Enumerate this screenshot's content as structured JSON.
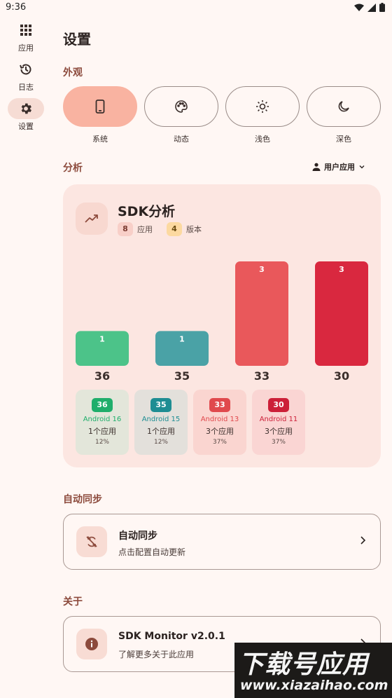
{
  "status_bar": {
    "time": "9:36"
  },
  "nav_rail": {
    "items": [
      {
        "label": "应用",
        "icon": "grid-icon",
        "active": false
      },
      {
        "label": "日志",
        "icon": "history-icon",
        "active": false
      },
      {
        "label": "设置",
        "icon": "gear-icon",
        "active": true
      }
    ]
  },
  "page": {
    "title": "设置"
  },
  "appearance": {
    "section_title": "外观",
    "options": [
      {
        "label": "系统",
        "icon": "phone-icon",
        "selected": true
      },
      {
        "label": "动态",
        "icon": "palette-icon",
        "selected": false
      },
      {
        "label": "浅色",
        "icon": "sun-icon",
        "selected": false
      },
      {
        "label": "深色",
        "icon": "moon-icon",
        "selected": false
      }
    ]
  },
  "analysis": {
    "section_title": "分析",
    "filter_label": "用户应用"
  },
  "sdk_card": {
    "title": "SDK分析",
    "apps_count": "8",
    "apps_label": "应用",
    "versions_count": "4",
    "versions_label": "版本"
  },
  "chart_data": {
    "type": "bar",
    "categories": [
      "36",
      "35",
      "33",
      "30"
    ],
    "values": [
      1,
      1,
      3,
      3
    ],
    "ylim": [
      0,
      3
    ],
    "colors": [
      "#4cc389",
      "#4aa2a6",
      "#e9585b",
      "#d9283f"
    ]
  },
  "legend_cards": [
    {
      "sdk": "36",
      "version": "Android 16",
      "apps": "1个应用",
      "percent": "12%",
      "color": "#1fae6b",
      "bg": "#e3e6da"
    },
    {
      "sdk": "35",
      "version": "Android 15",
      "apps": "1个应用",
      "percent": "12%",
      "color": "#1e8d93",
      "bg": "#e3e0db"
    },
    {
      "sdk": "33",
      "version": "Android 13",
      "apps": "3个应用",
      "percent": "37%",
      "color": "#e0494d",
      "bg": "#fad5d0"
    },
    {
      "sdk": "30",
      "version": "Android 11",
      "apps": "3个应用",
      "percent": "37%",
      "color": "#cc1f38",
      "bg": "#fad5d3"
    }
  ],
  "auto_sync": {
    "section_title": "自动同步",
    "title": "自动同步",
    "subtitle": "点击配置自动更新"
  },
  "about": {
    "section_title": "关于",
    "title": "SDK Monitor v2.0.1",
    "subtitle": "了解更多关于此应用"
  },
  "watermark": {
    "main": "下载号应用",
    "url": "www.xiazaihao.com"
  }
}
